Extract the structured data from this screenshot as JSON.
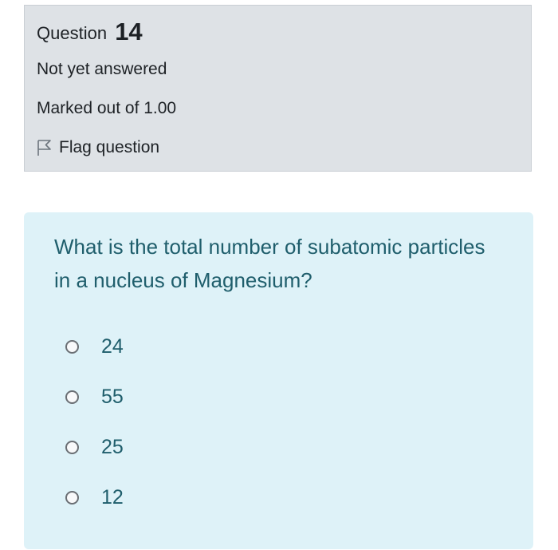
{
  "info": {
    "question_label": "Question",
    "question_number": "14",
    "state": "Not yet answered",
    "grade": "Marked out of 1.00",
    "flag_label": "Flag question",
    "flag_icon": "flag-outline-icon"
  },
  "question": {
    "text": "What is the total number of subatomic particles in a nucleus of Magnesium?",
    "answers": [
      {
        "label": "24",
        "selected": false
      },
      {
        "label": "55",
        "selected": false
      },
      {
        "label": "25",
        "selected": false
      },
      {
        "label": "12",
        "selected": false
      }
    ]
  },
  "colors": {
    "info_bg": "#dee2e6",
    "content_bg": "#def2f8",
    "content_text": "#1f5e6c"
  }
}
